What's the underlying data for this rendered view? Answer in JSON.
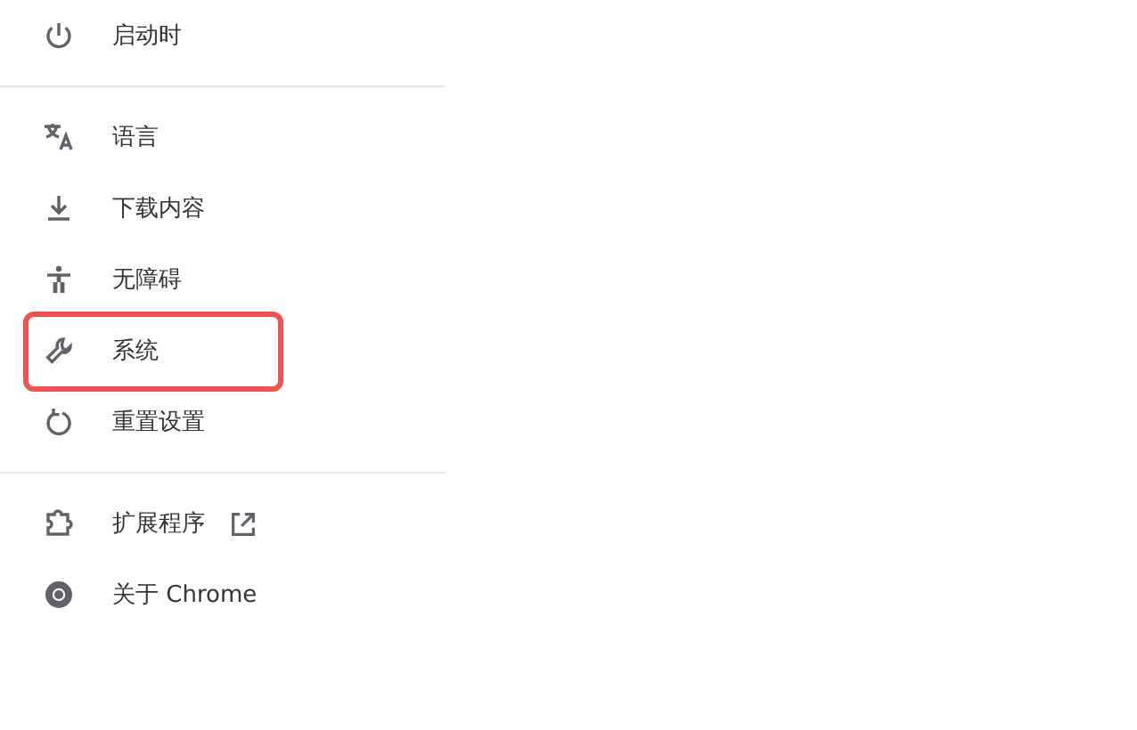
{
  "sidebar": {
    "groups": [
      {
        "items": [
          {
            "label": "启动时",
            "external": false,
            "highlighted": false
          }
        ]
      },
      {
        "items": [
          {
            "label": "语言",
            "external": false,
            "highlighted": false
          },
          {
            "label": "下载内容",
            "external": false,
            "highlighted": false
          },
          {
            "label": "无障碍",
            "external": false,
            "highlighted": false
          },
          {
            "label": "系统",
            "external": false,
            "highlighted": true
          },
          {
            "label": "重置设置",
            "external": false,
            "highlighted": false
          }
        ]
      },
      {
        "items": [
          {
            "label": "扩展程序",
            "external": true,
            "highlighted": false
          },
          {
            "label": "关于 Chrome",
            "external": false,
            "highlighted": false
          }
        ]
      }
    ]
  }
}
